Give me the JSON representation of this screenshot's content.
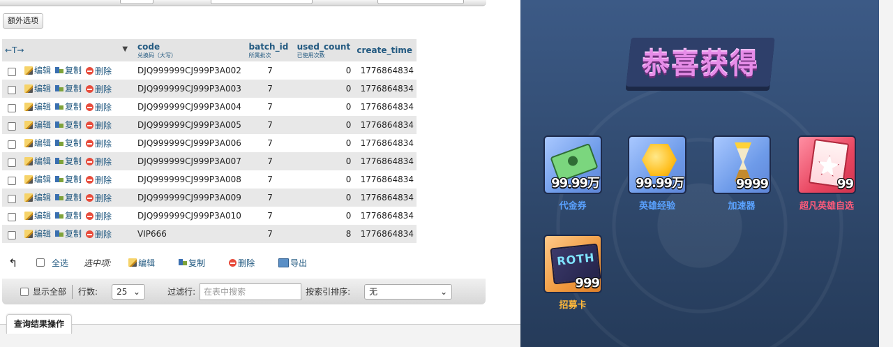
{
  "left": {
    "extra_options_label": "额外选项",
    "columns": [
      {
        "label": "code",
        "sub": "兑换码（大写）"
      },
      {
        "label": "batch_id",
        "sub": "所属批次"
      },
      {
        "label": "used_count",
        "sub": "已使用次数"
      },
      {
        "label": "create_time",
        "sub": ""
      }
    ],
    "col_toggle": "←T→",
    "sort_arrow": "▼",
    "actions": {
      "edit": "编辑",
      "copy": "复制",
      "delete": "删除"
    },
    "rows": [
      {
        "code": "DJQ999999CJ999P3A002",
        "batch_id": "7",
        "used_count": "0",
        "create_time": "1776864834"
      },
      {
        "code": "DJQ999999CJ999P3A003",
        "batch_id": "7",
        "used_count": "0",
        "create_time": "1776864834"
      },
      {
        "code": "DJQ999999CJ999P3A004",
        "batch_id": "7",
        "used_count": "0",
        "create_time": "1776864834"
      },
      {
        "code": "DJQ999999CJ999P3A005",
        "batch_id": "7",
        "used_count": "0",
        "create_time": "1776864834"
      },
      {
        "code": "DJQ999999CJ999P3A006",
        "batch_id": "7",
        "used_count": "0",
        "create_time": "1776864834"
      },
      {
        "code": "DJQ999999CJ999P3A007",
        "batch_id": "7",
        "used_count": "0",
        "create_time": "1776864834"
      },
      {
        "code": "DJQ999999CJ999P3A008",
        "batch_id": "7",
        "used_count": "0",
        "create_time": "1776864834"
      },
      {
        "code": "DJQ999999CJ999P3A009",
        "batch_id": "7",
        "used_count": "0",
        "create_time": "1776864834"
      },
      {
        "code": "DJQ999999CJ999P3A010",
        "batch_id": "7",
        "used_count": "0",
        "create_time": "1776864834"
      },
      {
        "code": "VIP666",
        "batch_id": "7",
        "used_count": "8",
        "create_time": "1776864834"
      }
    ],
    "bulk": {
      "select_all": "全选",
      "with_selected": "选中项:",
      "edit": "编辑",
      "copy": "复制",
      "delete": "删除",
      "export": "导出"
    },
    "filter": {
      "show_all": "显示全部",
      "rows_label": "行数:",
      "rows_value": "25",
      "filter_label": "过滤行:",
      "filter_placeholder": "在表中搜索",
      "sort_label": "按索引排序:",
      "sort_value": "无"
    },
    "query_ops_tab": "查询结果操作"
  },
  "game": {
    "banner_title": "恭喜获得",
    "rewards": [
      {
        "name": "代金券",
        "qty": "99.99万",
        "icon": "cash-icon",
        "color": "#5aa2ff"
      },
      {
        "name": "英雄经验",
        "qty": "99.99万",
        "icon": "honeycomb-icon",
        "color": "#5aa2ff"
      },
      {
        "name": "加速器",
        "qty": "9999",
        "icon": "hourglass-icon",
        "color": "#5aa2ff"
      },
      {
        "name": "超凡英雄自选",
        "qty": "99",
        "icon": "hero-pack-icon",
        "color": "#ff5a7a"
      },
      {
        "name": "招募卡",
        "qty": "999",
        "icon": "roth-card-icon",
        "color": "#ffb83a"
      }
    ],
    "roth_text": "ROTH"
  }
}
